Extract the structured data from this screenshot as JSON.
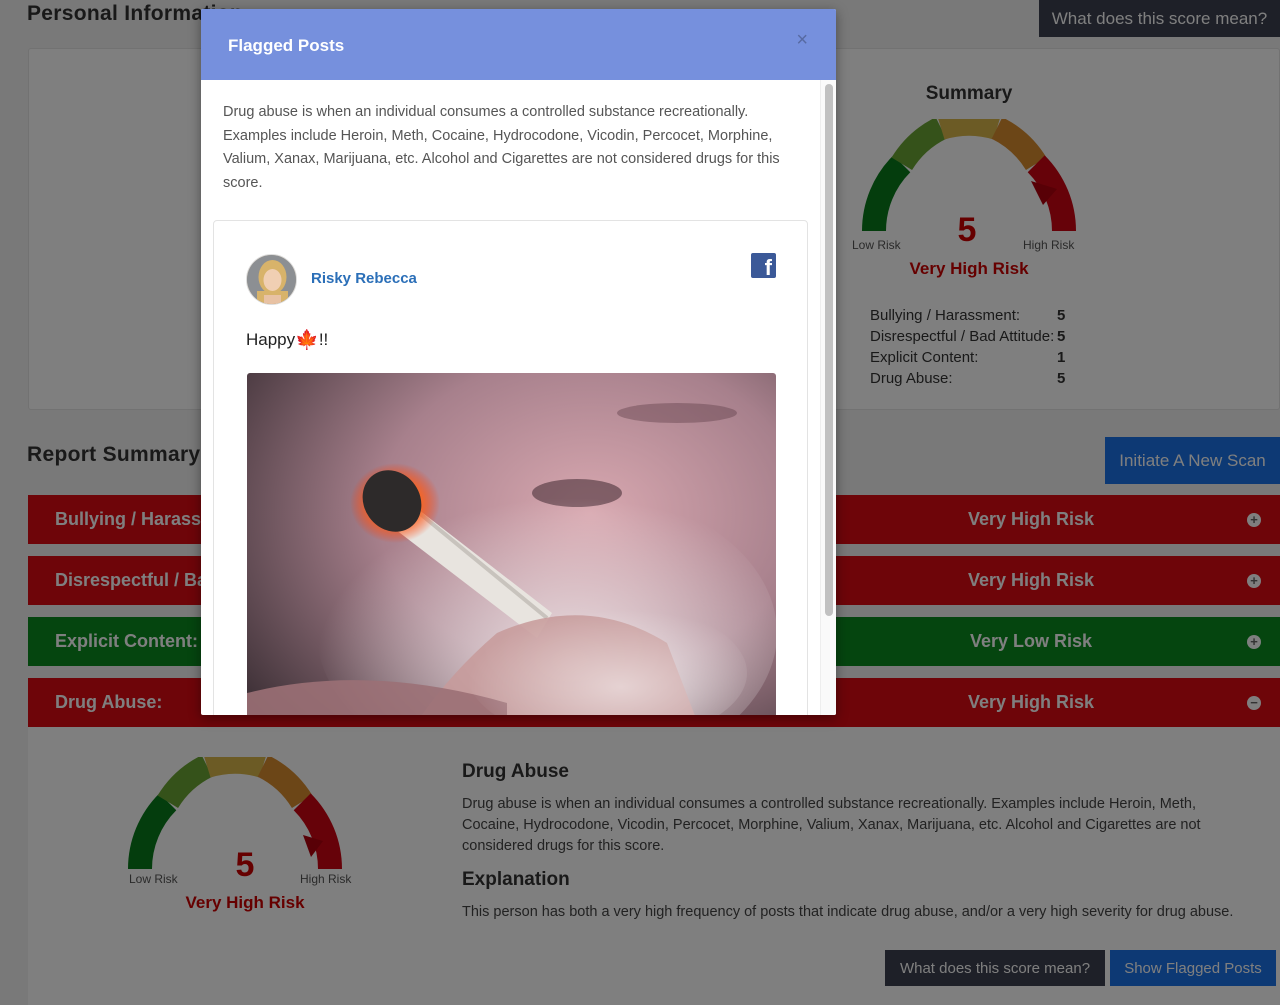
{
  "header": {
    "personal_info_title": "Personal Information",
    "score_meaning_button": "What does this score mean?"
  },
  "summary": {
    "title": "Summary",
    "score": "5",
    "level": "Very High Risk",
    "low_label": "Low Risk",
    "high_label": "High Risk",
    "rows": [
      {
        "label": "Bullying / Harassment:",
        "value": "5"
      },
      {
        "label": "Disrespectful / Bad Attitude:",
        "value": "5"
      },
      {
        "label": "Explicit Content:",
        "value": "1"
      },
      {
        "label": "Drug Abuse:",
        "value": "5"
      }
    ]
  },
  "report": {
    "title": "Report Summary",
    "new_scan_button": "Initiate A New Scan",
    "categories": [
      {
        "name": "Bullying / Harassment:",
        "level": "Very High Risk",
        "color": "#dd0a13",
        "toggle": "+"
      },
      {
        "name": "Disrespectful / Bad Attitude:",
        "level": "Very High Risk",
        "color": "#dd0a13",
        "toggle": "+"
      },
      {
        "name": "Explicit Content:",
        "level": "Very Low Risk",
        "color": "#0a8a1f",
        "toggle": "+"
      },
      {
        "name": "Drug Abuse:",
        "level": "Very High Risk",
        "color": "#dd0a13",
        "toggle": "−"
      }
    ]
  },
  "detail": {
    "score": "5",
    "level": "Very High Risk",
    "low_label": "Low Risk",
    "high_label": "High Risk",
    "heading": "Drug Abuse",
    "description": "Drug abuse is when an individual consumes a controlled substance recreationally. Examples include Heroin, Meth, Cocaine, Hydrocodone, Vicodin, Percocet, Morphine, Valium, Xanax, Marijuana, etc. Alcohol and Cigarettes are not considered drugs for this score.",
    "explanation_heading": "Explanation",
    "explanation": "This person has both a very high frequency of posts that indicate drug abuse, and/or a very high severity for drug abuse.",
    "score_meaning_button": "What does this score mean?",
    "show_flagged_button": "Show Flagged Posts"
  },
  "modal": {
    "title": "Flagged Posts",
    "close": "×",
    "description": "Drug abuse is when an individual consumes a controlled substance recreationally. Examples include Heroin, Meth, Cocaine, Hydrocodone, Vicodin, Percocet, Morphine, Valium, Xanax, Marijuana, etc. Alcohol and Cigarettes are not considered drugs for this score.",
    "post": {
      "author": "Risky Rebecca",
      "network_icon": "facebook-icon",
      "text": "Happy ",
      "emoji": "🍁",
      "text_suffix": "!!"
    }
  },
  "colors": {
    "danger": "#dd0a13",
    "safe": "#0a8a1f",
    "primary": "#1a73e8",
    "modal_header": "#7690dd"
  }
}
